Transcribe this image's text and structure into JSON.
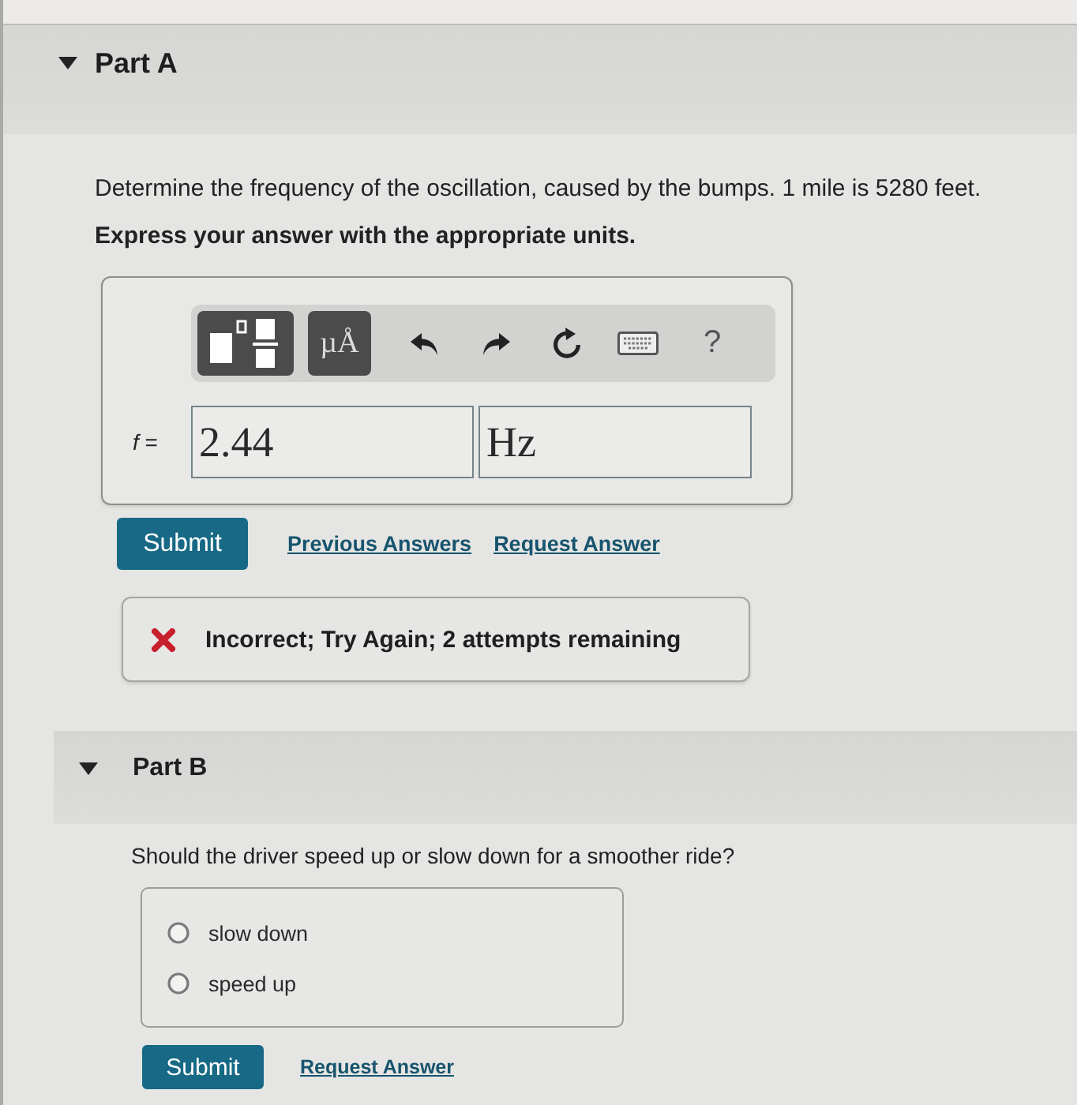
{
  "parts": [
    {
      "kind": "numeric",
      "title": "Part A",
      "expanded": true,
      "question": "Determine the frequency of the oscillation, caused by the bumps. 1 mile is 5280 feet.",
      "instruction": "Express your answer with the appropriate units.",
      "toolbar": [
        {
          "kind": "templates"
        },
        {
          "kind": "units",
          "label": "µÅ"
        },
        {
          "kind": "undo"
        },
        {
          "kind": "redo"
        },
        {
          "kind": "reset"
        },
        {
          "kind": "keyboard"
        },
        {
          "kind": "help",
          "label": "?"
        }
      ],
      "answer": {
        "label": "*f* =",
        "value": "2.44",
        "unit": "Hz"
      },
      "submit": "Submit",
      "links": [
        "Previous Answers",
        "Request Answer"
      ],
      "feedback": {
        "kind": "incorrect",
        "text": "Incorrect; Try Again; 2 attempts remaining"
      }
    },
    {
      "kind": "choice",
      "title": "Part B",
      "expanded": true,
      "question": "Should the driver speed up or slow down for a smoother ride?",
      "options": [
        {
          "label": "slow down",
          "selected": false
        },
        {
          "label": "speed up",
          "selected": false
        }
      ],
      "submit": "Submit",
      "links": [
        "Request Answer"
      ]
    }
  ]
}
